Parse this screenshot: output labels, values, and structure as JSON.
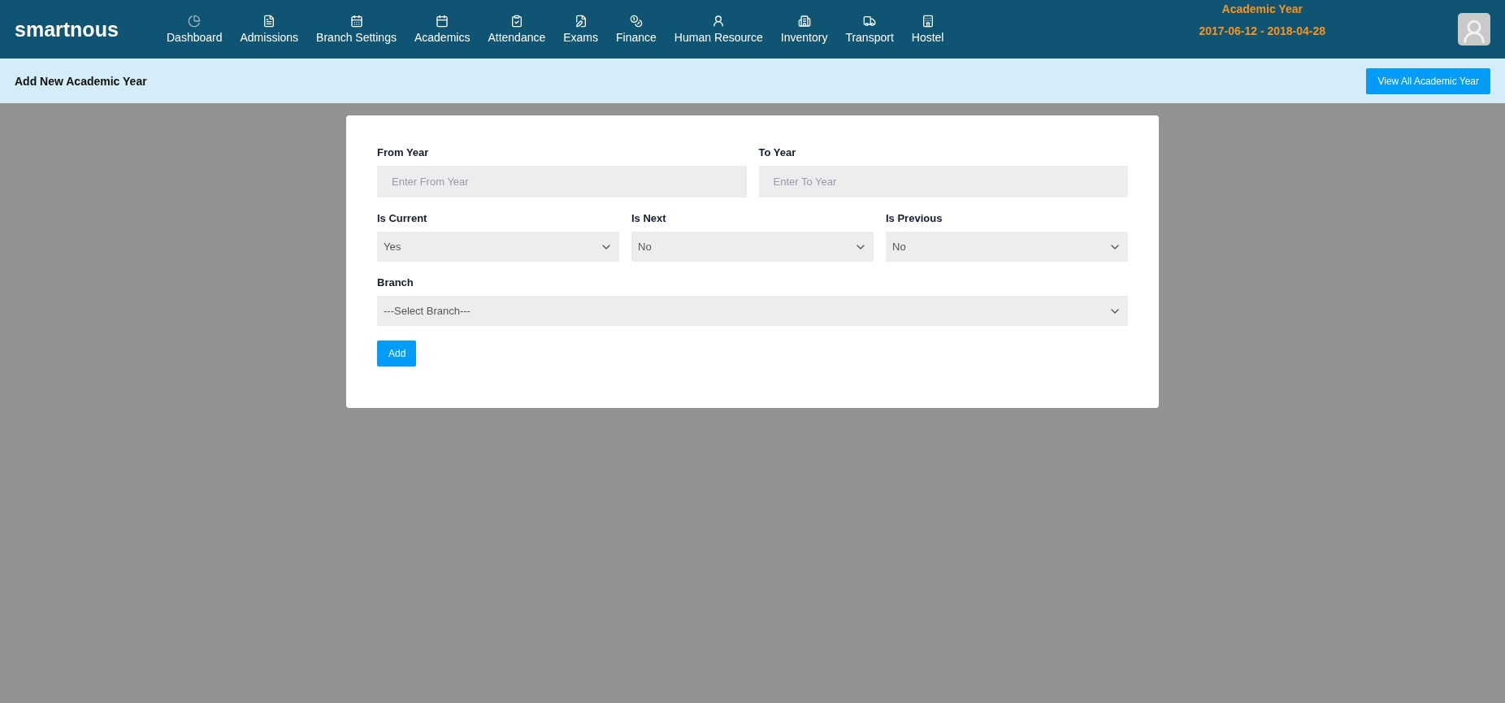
{
  "brand": "smartnous",
  "nav": [
    {
      "label": "Dashboard"
    },
    {
      "label": "Admissions"
    },
    {
      "label": "Branch Settings"
    },
    {
      "label": "Academics"
    },
    {
      "label": "Attendance"
    },
    {
      "label": "Exams"
    },
    {
      "label": "Finance"
    },
    {
      "label": "Human Resource"
    },
    {
      "label": "Inventory"
    },
    {
      "label": "Transport"
    },
    {
      "label": "Hostel"
    }
  ],
  "academic_year": {
    "title": "Academic Year",
    "range": "2017-06-12 - 2018-04-28"
  },
  "subheader": {
    "title": "Add New Academic Year",
    "button": "View All Academic Year"
  },
  "form": {
    "rows": [
      [
        {
          "kind": "input",
          "label": "From Year",
          "placeholder": "Enter From Year"
        },
        {
          "kind": "input",
          "label": "To Year",
          "placeholder": "Enter To Year"
        }
      ],
      [
        {
          "kind": "select",
          "label": "Is Current",
          "value": "Yes"
        },
        {
          "kind": "select",
          "label": "Is Next",
          "value": "No"
        },
        {
          "kind": "select",
          "label": "Is Previous",
          "value": "No"
        }
      ],
      [
        {
          "kind": "select",
          "label": "Branch",
          "value": "---Select Branch---"
        }
      ]
    ],
    "submit": "Add"
  }
}
